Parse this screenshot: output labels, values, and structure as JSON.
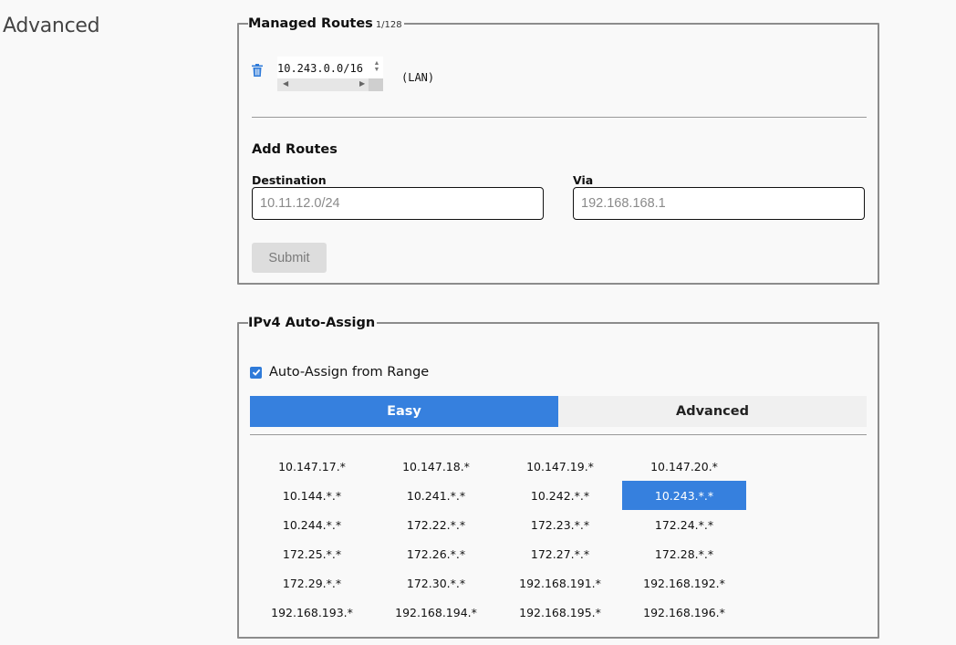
{
  "section": {
    "title": "Advanced"
  },
  "managed_routes": {
    "legend": "Managed Routes",
    "count": "1/128",
    "routes": [
      {
        "target": "10.243.0.0/16",
        "via": "(LAN)"
      }
    ],
    "add_title": "Add Routes",
    "destination_label": "Destination",
    "destination_placeholder": "10.11.12.0/24",
    "via_label": "Via",
    "via_placeholder": "192.168.168.1",
    "submit_label": "Submit"
  },
  "ipv4": {
    "legend": "IPv4 Auto-Assign",
    "checkbox_label": "Auto-Assign from Range",
    "checked": true,
    "tabs": [
      {
        "label": "Easy",
        "active": true
      },
      {
        "label": "Advanced",
        "active": false
      }
    ],
    "ranges": [
      "10.147.17.*",
      "10.147.18.*",
      "10.147.19.*",
      "10.147.20.*",
      "10.144.*.*",
      "10.241.*.*",
      "10.242.*.*",
      "10.243.*.*",
      "10.244.*.*",
      "172.22.*.*",
      "172.23.*.*",
      "172.24.*.*",
      "172.25.*.*",
      "172.26.*.*",
      "172.27.*.*",
      "172.28.*.*",
      "172.29.*.*",
      "172.30.*.*",
      "192.168.191.*",
      "192.168.192.*",
      "192.168.193.*",
      "192.168.194.*",
      "192.168.195.*",
      "192.168.196.*"
    ],
    "selected_range": "10.243.*.*"
  },
  "colors": {
    "accent": "#3680de",
    "border": "#8c8c8c"
  }
}
